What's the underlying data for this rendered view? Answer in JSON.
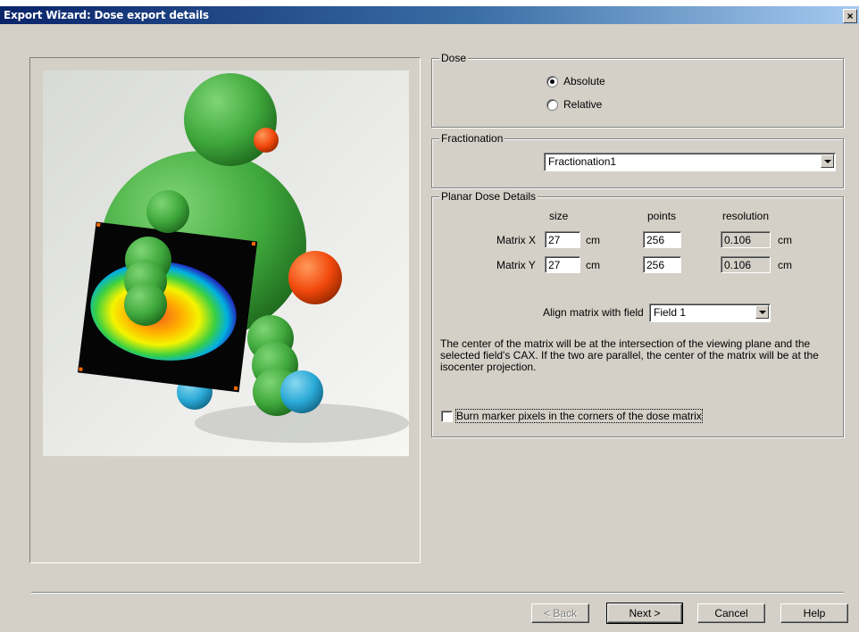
{
  "window": {
    "title": "Export Wizard: Dose export details",
    "close_label": "×"
  },
  "dose": {
    "group_label": "Dose",
    "options": [
      {
        "label": "Absolute",
        "checked": true
      },
      {
        "label": "Relative",
        "checked": false
      }
    ]
  },
  "fractionation": {
    "group_label": "Fractionation",
    "selected": "Fractionation1"
  },
  "planar": {
    "group_label": "Planar Dose Details",
    "col_size": "size",
    "col_points": "points",
    "col_resolution": "resolution",
    "rows": [
      {
        "label": "Matrix X",
        "size": "27",
        "size_unit": "cm",
        "points": "256",
        "resolution": "0.106",
        "res_unit": "cm"
      },
      {
        "label": "Matrix Y",
        "size": "27",
        "size_unit": "cm",
        "points": "256",
        "resolution": "0.106",
        "res_unit": "cm"
      }
    ],
    "align_label": "Align matrix with field",
    "align_value": "Field 1",
    "description": "The center of the matrix will be at the intersection of the viewing plane and the selected field's CAX. If the two are parallel, the center of the matrix will be at the isocenter projection.",
    "burn_label": "Burn marker pixels in the corners of the dose matrix",
    "burn_checked": false
  },
  "buttons": {
    "back": "< Back",
    "next": "Next >",
    "cancel": "Cancel",
    "help": "Help"
  },
  "colors": {
    "title_start": "#0a246a",
    "title_end": "#a6caf0",
    "face": "#d4d0c8",
    "figure_green": "#3fa83c",
    "figure_blue": "#2aa9d6",
    "figure_orange": "#f2480c"
  }
}
